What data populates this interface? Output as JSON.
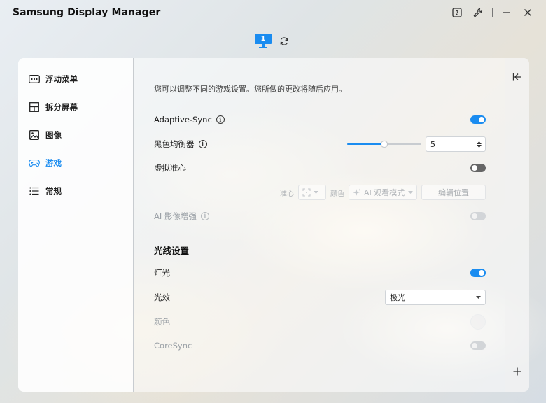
{
  "app": {
    "title": "Samsung Display Manager"
  },
  "monitor": {
    "number": "1"
  },
  "sidebar": {
    "items": [
      {
        "label": "浮动菜单",
        "icon": "floating-menu-icon",
        "active": false
      },
      {
        "label": "拆分屏幕",
        "icon": "split-screen-icon",
        "active": false
      },
      {
        "label": "图像",
        "icon": "image-icon",
        "active": false
      },
      {
        "label": "游戏",
        "icon": "gamepad-icon",
        "active": true
      },
      {
        "label": "常规",
        "icon": "list-icon",
        "active": false
      }
    ]
  },
  "content": {
    "description": "您可以调整不同的游戏设置。您所做的更改将随后应用。",
    "adaptive_sync": {
      "label": "Adaptive-Sync",
      "enabled": true
    },
    "black_equalizer": {
      "label": "黑色均衡器",
      "value": "5",
      "level_fraction": 0.5
    },
    "virtual_aim": {
      "label": "虚拟准心",
      "enabled": false
    },
    "crosshair": {
      "aim_label": "准心",
      "color_label": "颜色",
      "color_value": "AI 观看模式",
      "edit_label": "编辑位置"
    },
    "ai_enhance": {
      "label": "AI 影像增强",
      "enabled": false
    },
    "lighting_section": {
      "title": "光线设置"
    },
    "light": {
      "label": "灯光",
      "enabled": true
    },
    "light_effect": {
      "label": "光效",
      "value": "极光"
    },
    "light_color": {
      "label": "颜色"
    },
    "coresync": {
      "label": "CoreSync",
      "enabled": false
    }
  },
  "colors": {
    "accent": "#1a8cf0"
  }
}
